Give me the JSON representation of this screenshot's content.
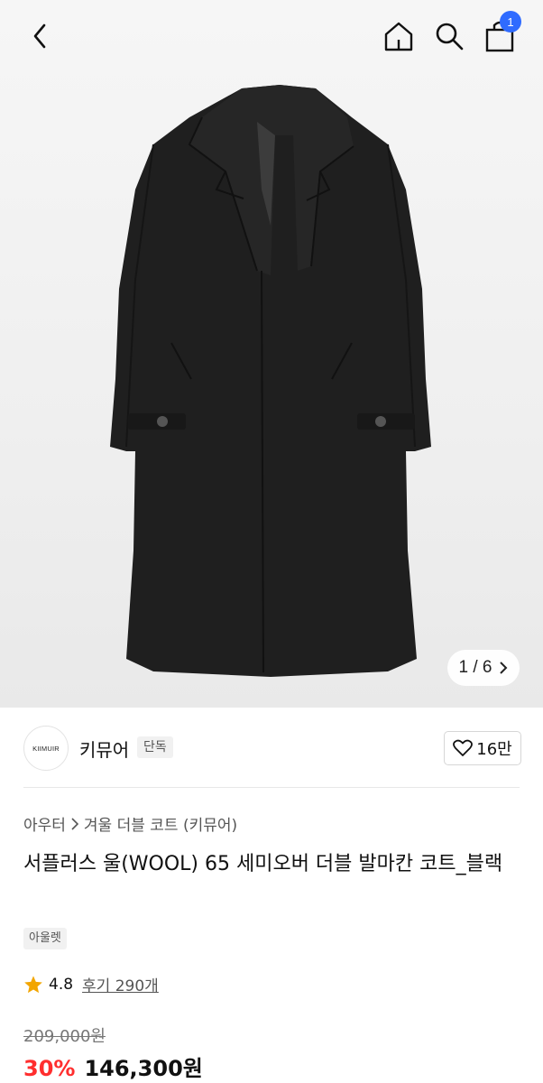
{
  "topbar": {
    "cart_count": "1"
  },
  "gallery": {
    "counter": "1 / 6"
  },
  "brand": {
    "logo_text": "KIIMUIR",
    "name": "키뮤어",
    "tag": "단독",
    "likes": "16만"
  },
  "breadcrumb": {
    "category": "아우터",
    "subcategory": "겨울 더블 코트 (키뮤어)"
  },
  "product": {
    "title": "서플러스 울(WOOL) 65 세미오버 더블 발마칸 코트_블랙",
    "chip": "아울렛"
  },
  "rating": {
    "score": "4.8",
    "reviews": "후기 290개"
  },
  "price": {
    "original": "209,000원",
    "discount": "30%",
    "sale": "146,300원"
  },
  "colors": {
    "accent": "#2f6bff",
    "discount": "#ff2e2e",
    "star": "#f2a500"
  }
}
